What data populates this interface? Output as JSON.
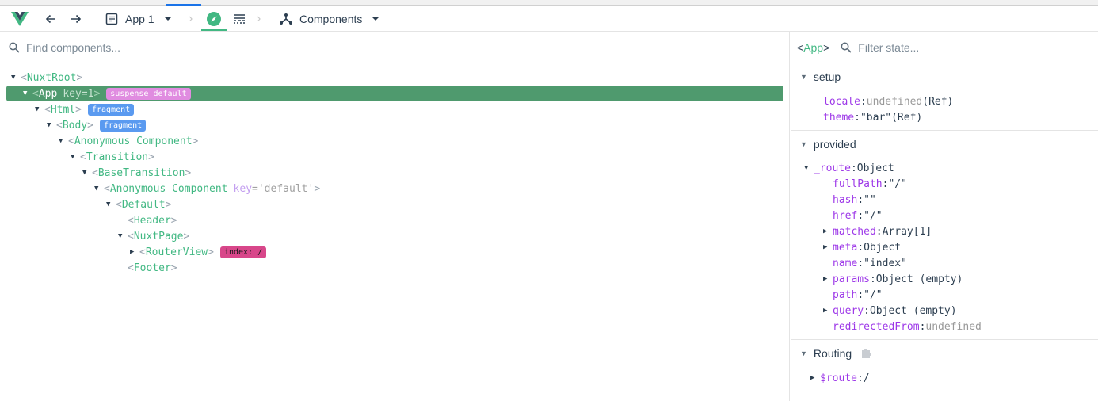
{
  "toolbar": {
    "app_selector": "App 1",
    "inspector": "Components",
    "colors": {
      "accent": "#42b883",
      "selected_row": "#4f9a6e",
      "key": "#9d38e8"
    }
  },
  "left": {
    "search_placeholder": "Find components...",
    "tree": [
      {
        "depth": 0,
        "expanded": true,
        "name": "NuxtRoot"
      },
      {
        "depth": 1,
        "expanded": true,
        "name": "App",
        "key_name": "key",
        "key_value": "=1",
        "badge": "suspense default",
        "selected": true
      },
      {
        "depth": 2,
        "expanded": true,
        "name": "Html",
        "badge": "fragment"
      },
      {
        "depth": 3,
        "expanded": true,
        "name": "Body",
        "badge": "fragment"
      },
      {
        "depth": 4,
        "expanded": true,
        "name": "Anonymous Component"
      },
      {
        "depth": 5,
        "expanded": true,
        "name": "Transition"
      },
      {
        "depth": 6,
        "expanded": true,
        "name": "BaseTransition"
      },
      {
        "depth": 7,
        "expanded": true,
        "name": "Anonymous Component",
        "key_name": "key",
        "key_value": "='default'"
      },
      {
        "depth": 8,
        "expanded": true,
        "name": "Default"
      },
      {
        "depth": 9,
        "name": "Header"
      },
      {
        "depth": 9,
        "expanded": true,
        "name": "NuxtPage"
      },
      {
        "depth": 10,
        "expanded": false,
        "name": "RouterView",
        "badge": "index: /"
      },
      {
        "depth": 9,
        "name": "Footer"
      }
    ]
  },
  "right": {
    "component": "App",
    "filter_placeholder": "Filter state...",
    "sections": {
      "setup": {
        "title": "setup",
        "props": [
          {
            "key": "locale",
            "value": "undefined",
            "suffix": "(Ref)"
          },
          {
            "key": "theme",
            "value": "\"bar\"",
            "suffix": "(Ref)"
          }
        ]
      },
      "provided": {
        "title": "provided",
        "root": {
          "key": "_route",
          "value": "Object"
        },
        "props": [
          {
            "key": "fullPath",
            "value": "\"/\""
          },
          {
            "key": "hash",
            "value": "\"\""
          },
          {
            "key": "href",
            "value": "\"/\""
          },
          {
            "key": "matched",
            "value": "Array[1]",
            "collapsed": true
          },
          {
            "key": "meta",
            "value": "Object",
            "collapsed": true
          },
          {
            "key": "name",
            "value": "\"index\""
          },
          {
            "key": "params",
            "value": "Object (empty)",
            "collapsed": true
          },
          {
            "key": "path",
            "value": "\"/\""
          },
          {
            "key": "query",
            "value": "Object (empty)",
            "collapsed": true
          },
          {
            "key": "redirectedFrom",
            "value": "undefined"
          }
        ]
      },
      "routing": {
        "title": "Routing",
        "props": [
          {
            "key": "$route",
            "value": "/"
          }
        ]
      }
    }
  }
}
